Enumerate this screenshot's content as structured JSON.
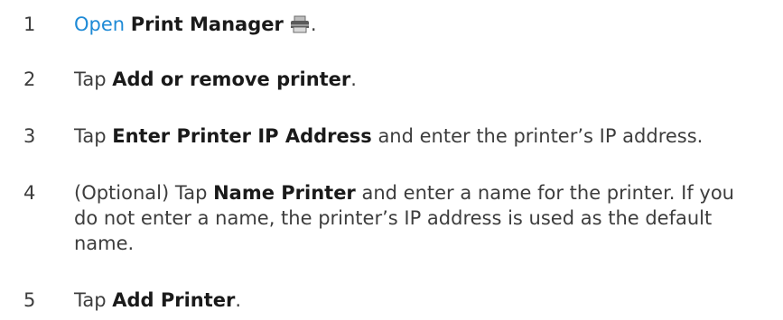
{
  "steps": [
    {
      "number": "1",
      "link": "Open",
      "bold": "Print Manager",
      "icon": "printer-icon",
      "after": "."
    },
    {
      "number": "2",
      "before": "Tap ",
      "bold": "Add or remove printer",
      "after": "."
    },
    {
      "number": "3",
      "before": "Tap ",
      "bold": "Enter Printer IP Address",
      "after": " and enter the printer’s IP address."
    },
    {
      "number": "4",
      "before": "(Optional) Tap ",
      "bold": "Name Printer",
      "after": " and enter a name for the printer. If you do not enter a name, the printer’s IP address is used as the default name."
    },
    {
      "number": "5",
      "before": "Tap ",
      "bold": "Add Printer",
      "after": "."
    }
  ]
}
